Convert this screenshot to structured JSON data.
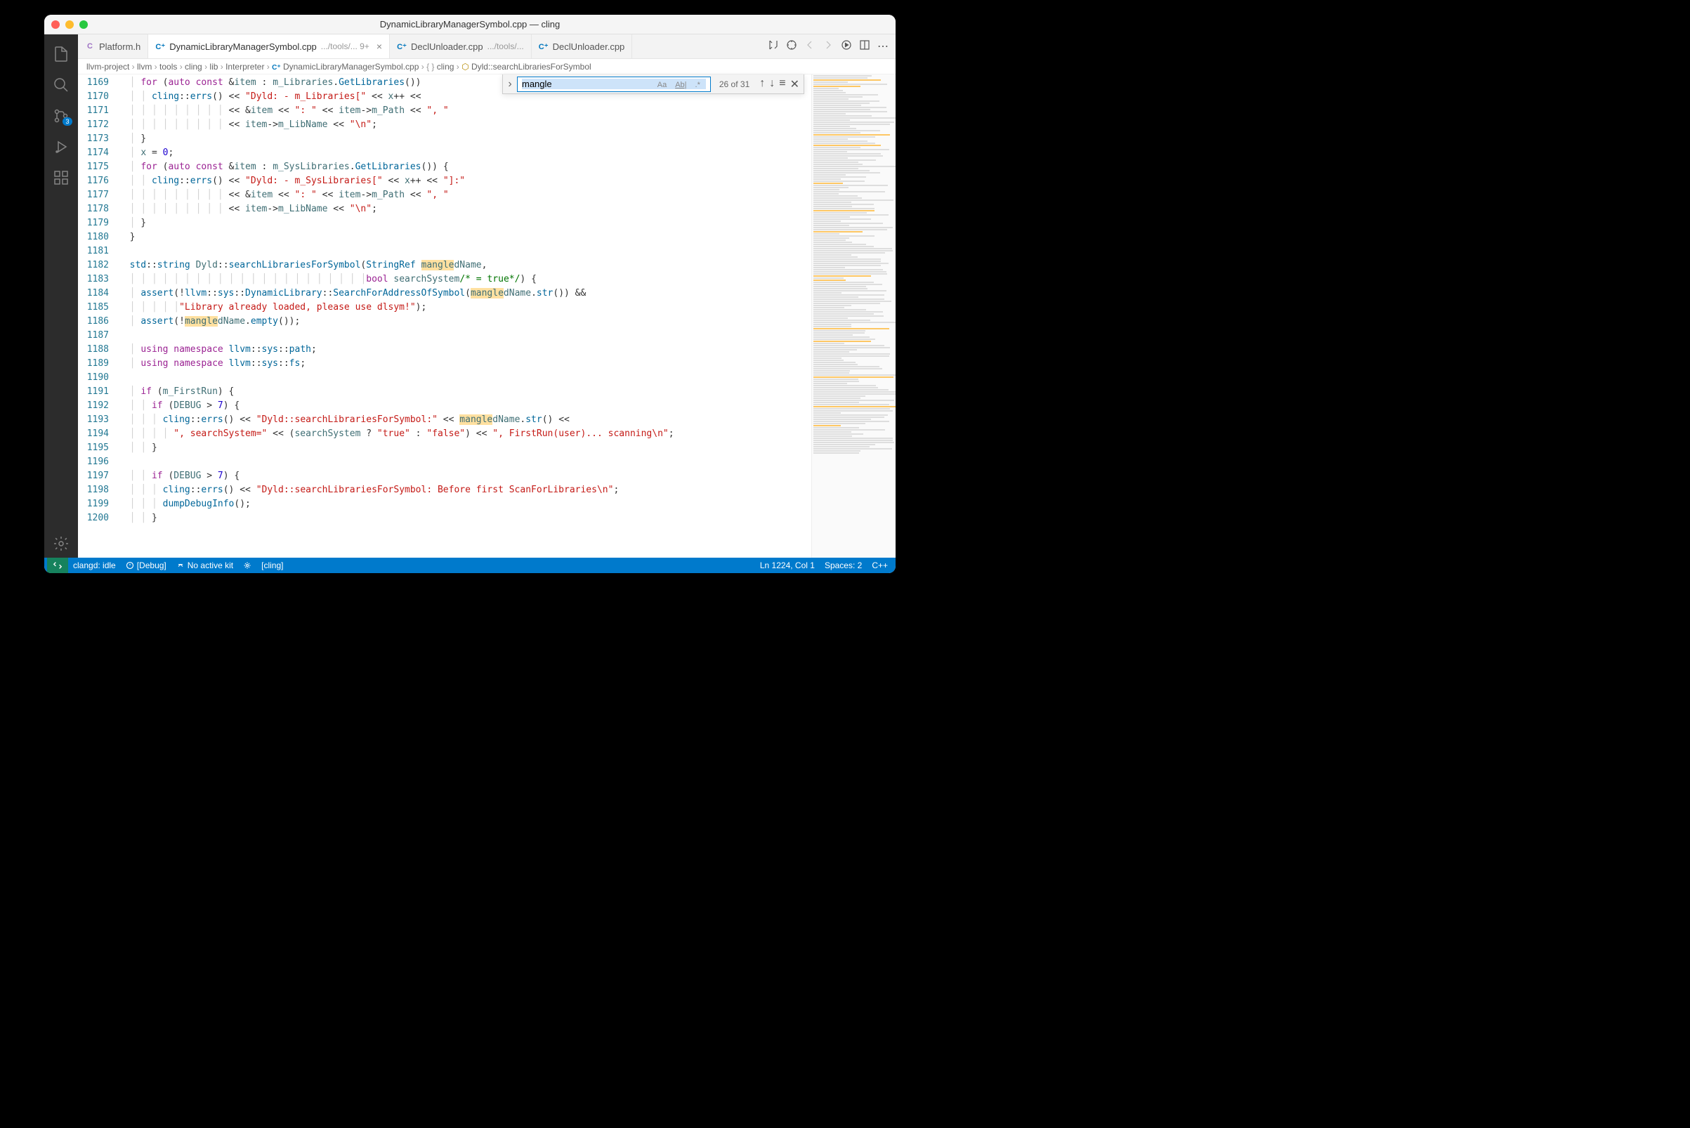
{
  "title": "DynamicLibraryManagerSymbol.cpp — cling",
  "tabs": [
    {
      "icon": "C",
      "iconColor": "#a074c4",
      "label": "Platform.h",
      "suffix": "",
      "active": false,
      "close": false
    },
    {
      "icon": "C⁺",
      "iconColor": "#0277bd",
      "label": "DynamicLibraryManagerSymbol.cpp",
      "suffix": ".../tools/... 9+",
      "active": true,
      "close": true
    },
    {
      "icon": "C⁺",
      "iconColor": "#0277bd",
      "label": "DeclUnloader.cpp",
      "suffix": ".../tools/...",
      "active": false,
      "close": false
    },
    {
      "icon": "C⁺",
      "iconColor": "#0277bd",
      "label": "DeclUnloader.cpp",
      "suffix": "",
      "active": false,
      "close": false
    }
  ],
  "breadcrumb": {
    "parts": [
      "llvm-project",
      "llvm",
      "tools",
      "cling",
      "lib",
      "Interpreter"
    ],
    "file": "DynamicLibraryManagerSymbol.cpp",
    "ns": "cling",
    "symbol": "Dyld::searchLibrariesForSymbol"
  },
  "find": {
    "query": "mangle",
    "count": "26 of 31",
    "opts": [
      "Aa",
      "Ab|",
      ".*"
    ]
  },
  "activity": {
    "scm_badge": "3"
  },
  "gutter_start": 1169,
  "gutter_end": 1200,
  "code": [
    "    for (auto const &item : m_Libraries.GetLibraries())",
    "      cling::errs() << \"Dyld: - m_Libraries[\" << x++ <<",
    "                    << &item << \": \" << item->m_Path << \", \"",
    "                    << item->m_LibName << \"\\n\";",
    "    }",
    "    x = 0;",
    "    for (auto const &item : m_SysLibraries.GetLibraries()) {",
    "      cling::errs() << \"Dyld: - m_SysLibraries[\" << x++ << \"]:\"",
    "                    << &item << \": \" << item->m_Path << \", \"",
    "                    << item->m_LibName << \"\\n\";",
    "    }",
    "  }",
    "",
    "  std::string Dyld::searchLibrariesForSymbol(StringRef mangledName,",
    "                                             bool searchSystem/* = true*/) {",
    "    assert(!llvm::sys::DynamicLibrary::SearchForAddressOfSymbol(mangledName.str()) &&",
    "           \"Library already loaded, please use dlsym!\");",
    "    assert(!mangledName.empty());",
    "",
    "    using namespace llvm::sys::path;",
    "    using namespace llvm::sys::fs;",
    "",
    "    if (m_FirstRun) {",
    "      if (DEBUG > 7) {",
    "        cling::errs() << \"Dyld::searchLibrariesForSymbol:\" << mangledName.str() <<",
    "          \", searchSystem=\" << (searchSystem ? \"true\" : \"false\") << \", FirstRun(user)... scanning\\n\";",
    "      }",
    "",
    "      if (DEBUG > 7) {",
    "        cling::errs() << \"Dyld::searchLibrariesForSymbol: Before first ScanForLibraries\\n\";",
    "        dumpDebugInfo();",
    "      }"
  ],
  "status": {
    "remote": "",
    "clangd": "clangd: idle",
    "debug": "[Debug]",
    "kit": "No active kit",
    "cling": "[cling]",
    "pos": "Ln 1224, Col 1",
    "spaces": "Spaces: 2",
    "lang": "C++"
  }
}
